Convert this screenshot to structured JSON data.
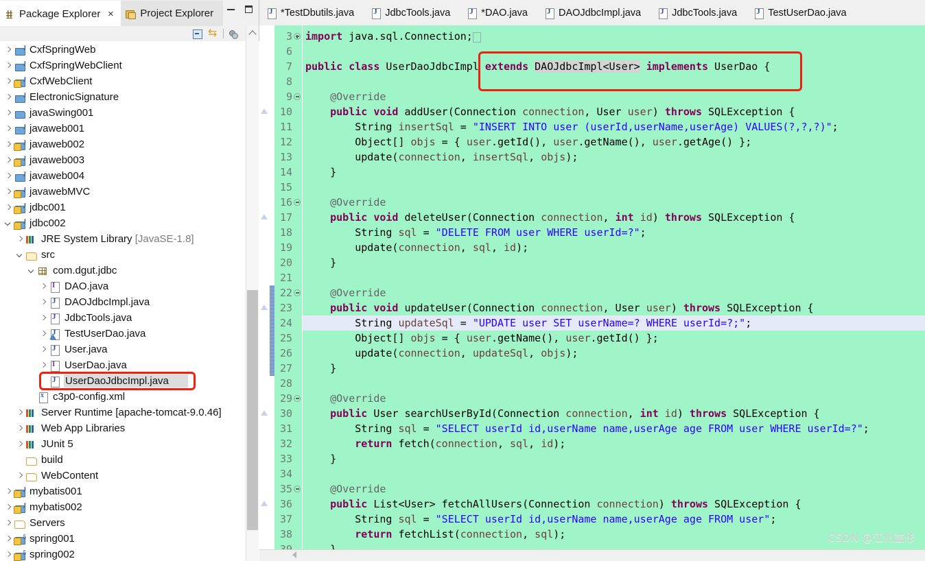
{
  "left_panel": {
    "tabs": [
      {
        "label": "Package Explorer",
        "icon": "package-explorer-icon",
        "active": true,
        "close": "×"
      },
      {
        "label": "Project Explorer",
        "icon": "project-explorer-icon",
        "active": false
      }
    ],
    "window_buttons": {
      "minimize": "minimize",
      "maximize": "maximize"
    },
    "toolbar": [
      {
        "name": "collapse-all-icon"
      },
      {
        "name": "link-with-editor-icon"
      },
      {
        "name": "view-menu-icon"
      },
      {
        "name": "view-menu-dots-icon"
      }
    ],
    "tree": [
      {
        "indent": 0,
        "twisty": "right",
        "icon": "java-web-project-icon",
        "label": "CxfSpringWeb"
      },
      {
        "indent": 0,
        "twisty": "right",
        "icon": "java-web-project-icon",
        "label": "CxfSpringWebClient"
      },
      {
        "indent": 0,
        "twisty": "right",
        "icon": "java-web-project-warn-icon",
        "label": "CxfWebClient"
      },
      {
        "indent": 0,
        "twisty": "right",
        "icon": "java-web-project-icon",
        "label": "ElectronicSignature"
      },
      {
        "indent": 0,
        "twisty": "right",
        "icon": "java-project-icon",
        "label": "javaSwing001"
      },
      {
        "indent": 0,
        "twisty": "right",
        "icon": "dynamic-web-project-icon",
        "label": "javaweb001"
      },
      {
        "indent": 0,
        "twisty": "right",
        "icon": "dynamic-web-project-warn-icon",
        "label": "javaweb002"
      },
      {
        "indent": 0,
        "twisty": "right",
        "icon": "dynamic-web-project-warn-icon",
        "label": "javaweb003"
      },
      {
        "indent": 0,
        "twisty": "right",
        "icon": "dynamic-web-project-icon",
        "label": "javaweb004"
      },
      {
        "indent": 0,
        "twisty": "right",
        "icon": "dynamic-web-project-warn-icon",
        "label": "javawebMVC"
      },
      {
        "indent": 0,
        "twisty": "right",
        "icon": "dynamic-web-project-warn-icon",
        "label": "jdbc001"
      },
      {
        "indent": 0,
        "twisty": "down",
        "icon": "dynamic-web-project-warn-icon",
        "label": "jdbc002"
      },
      {
        "indent": 1,
        "twisty": "right",
        "icon": "library-icon",
        "label": "JRE System Library ",
        "suffix": "[JavaSE-1.8]"
      },
      {
        "indent": 1,
        "twisty": "down",
        "icon": "source-folder-icon",
        "label": "src"
      },
      {
        "indent": 2,
        "twisty": "down",
        "icon": "package-icon",
        "label": "com.dgut.jdbc"
      },
      {
        "indent": 3,
        "twisty": "right",
        "icon": "java-interface-icon",
        "label": "DAO.java"
      },
      {
        "indent": 3,
        "twisty": "right",
        "icon": "java-class-icon",
        "label": "DAOJdbcImpl.java"
      },
      {
        "indent": 3,
        "twisty": "right",
        "icon": "java-class-icon",
        "label": "JdbcTools.java"
      },
      {
        "indent": 3,
        "twisty": "right",
        "icon": "java-test-class-icon",
        "label": "TestUserDao.java"
      },
      {
        "indent": 3,
        "twisty": "right",
        "icon": "java-class-icon",
        "label": "User.java"
      },
      {
        "indent": 3,
        "twisty": "right",
        "icon": "java-interface-icon",
        "label": "UserDao.java"
      },
      {
        "indent": 3,
        "twisty": "none",
        "icon": "java-class-icon",
        "label": "UserDaoJdbcImpl.java",
        "selected": true,
        "highlighted": true
      },
      {
        "indent": 2,
        "twisty": "none",
        "icon": "xml-file-icon",
        "label": "c3p0-config.xml"
      },
      {
        "indent": 1,
        "twisty": "right",
        "icon": "library-icon",
        "label": "Server Runtime [apache-tomcat-9.0.46]"
      },
      {
        "indent": 1,
        "twisty": "right",
        "icon": "library-icon",
        "label": "Web App Libraries"
      },
      {
        "indent": 1,
        "twisty": "right",
        "icon": "library-icon",
        "label": "JUnit 5"
      },
      {
        "indent": 1,
        "twisty": "none",
        "icon": "folder-icon",
        "label": "build"
      },
      {
        "indent": 1,
        "twisty": "right",
        "icon": "folder-icon",
        "label": "WebContent"
      },
      {
        "indent": 0,
        "twisty": "right",
        "icon": "dynamic-web-project-warn-icon",
        "label": "mybatis001"
      },
      {
        "indent": 0,
        "twisty": "right",
        "icon": "dynamic-web-project-warn-icon",
        "label": "mybatis002"
      },
      {
        "indent": 0,
        "twisty": "right",
        "icon": "folder-icon",
        "label": "Servers"
      },
      {
        "indent": 0,
        "twisty": "right",
        "icon": "spring-project-warn-icon",
        "label": "spring001"
      },
      {
        "indent": 0,
        "twisty": "right",
        "icon": "spring-project-warn-icon",
        "label": "spring002"
      }
    ]
  },
  "editor": {
    "tabs": [
      {
        "label": "*TestDbutils.java",
        "dirty": true
      },
      {
        "label": "JdbcTools.java",
        "dirty": false
      },
      {
        "label": "*DAO.java",
        "dirty": true
      },
      {
        "label": "DAOJdbcImpl.java",
        "dirty": false
      },
      {
        "label": "JdbcTools.java",
        "dirty": false
      },
      {
        "label": "TestUserDao.java",
        "dirty": false
      }
    ],
    "background_color": "#a0f5c8",
    "current_line_color": "#e4eaf7",
    "occurrence_highlight_color": "#d4d4d4",
    "annotation_box_color": "#ee2211",
    "lines": [
      {
        "num": "3",
        "fold": "plus",
        "ann": "none",
        "change": false,
        "current": false,
        "html": "<span class=\"kw\">import</span> java.sql.Connection;<span style=\"color:#9aa;border:1px solid #9ab;padding:0 2px;font-size:11px\">&nbsp;</span>"
      },
      {
        "num": "6",
        "fold": "none",
        "ann": "none",
        "change": false,
        "current": false,
        "html": ""
      },
      {
        "num": "7",
        "fold": "none",
        "ann": "none",
        "change": false,
        "current": false,
        "html": "<span class=\"kw\">public</span> <span class=\"kw\">class</span> UserDaoJdbcImpl <span class=\"kw\">extends</span> <span class=\"occ\">DAOJdbcImpl&lt;User&gt;</span> <span class=\"kw\">implements</span> UserDao {"
      },
      {
        "num": "8",
        "fold": "none",
        "ann": "none",
        "change": false,
        "current": false,
        "html": ""
      },
      {
        "num": "9",
        "fold": "minus",
        "ann": "none",
        "change": false,
        "current": false,
        "html": "    <span class=\"ann\">@Override</span>"
      },
      {
        "num": "10",
        "fold": "none",
        "ann": "impl",
        "change": false,
        "current": false,
        "html": "    <span class=\"kw\">public</span> <span class=\"kw\">void</span> addUser(Connection <span class=\"var\">connection</span>, User <span class=\"var\">user</span>) <span class=\"kw\">throws</span> SQLException {"
      },
      {
        "num": "11",
        "fold": "none",
        "ann": "none",
        "change": false,
        "current": false,
        "html": "        String <span class=\"var\">insertSql</span> = <span class=\"str\">\"INSERT INTO user (userId,userName,userAge) VALUES(?,?,?)\"</span>;"
      },
      {
        "num": "12",
        "fold": "none",
        "ann": "none",
        "change": false,
        "current": false,
        "html": "        Object[] <span class=\"var\">objs</span> = { <span class=\"var\">user</span>.getId(), <span class=\"var\">user</span>.getName(), <span class=\"var\">user</span>.getAge() };"
      },
      {
        "num": "13",
        "fold": "none",
        "ann": "none",
        "change": false,
        "current": false,
        "html": "        update(<span class=\"var\">connection</span>, <span class=\"var\">insertSql</span>, <span class=\"var\">objs</span>);"
      },
      {
        "num": "14",
        "fold": "none",
        "ann": "none",
        "change": false,
        "current": false,
        "html": "    }"
      },
      {
        "num": "15",
        "fold": "none",
        "ann": "none",
        "change": false,
        "current": false,
        "html": ""
      },
      {
        "num": "16",
        "fold": "minus",
        "ann": "none",
        "change": false,
        "current": false,
        "html": "    <span class=\"ann\">@Override</span>"
      },
      {
        "num": "17",
        "fold": "none",
        "ann": "impl",
        "change": false,
        "current": false,
        "html": "    <span class=\"kw\">public</span> <span class=\"kw\">void</span> deleteUser(Connection <span class=\"var\">connection</span>, <span class=\"kw\">int</span> <span class=\"var\">id</span>) <span class=\"kw\">throws</span> SQLException {"
      },
      {
        "num": "18",
        "fold": "none",
        "ann": "none",
        "change": false,
        "current": false,
        "html": "        String <span class=\"var\">sql</span> = <span class=\"str\">\"DELETE FROM user WHERE userId=?\"</span>;"
      },
      {
        "num": "19",
        "fold": "none",
        "ann": "none",
        "change": false,
        "current": false,
        "html": "        update(<span class=\"var\">connection</span>, <span class=\"var\">sql</span>, <span class=\"var\">id</span>);"
      },
      {
        "num": "20",
        "fold": "none",
        "ann": "none",
        "change": false,
        "current": false,
        "html": "    }"
      },
      {
        "num": "21",
        "fold": "none",
        "ann": "none",
        "change": false,
        "current": false,
        "html": ""
      },
      {
        "num": "22",
        "fold": "minus",
        "ann": "none",
        "change": true,
        "current": false,
        "html": "    <span class=\"ann\">@Override</span>"
      },
      {
        "num": "23",
        "fold": "none",
        "ann": "impl",
        "change": true,
        "current": false,
        "html": "    <span class=\"kw\">public</span> <span class=\"kw\">void</span> updateUser(Connection <span class=\"var\">connection</span>, User <span class=\"var\">user</span>) <span class=\"kw\">throws</span> SQLException {"
      },
      {
        "num": "24",
        "fold": "none",
        "ann": "none",
        "change": true,
        "current": true,
        "html": "        String <span class=\"var\">updateSql</span> = <span class=\"str\">\"UPDATE user SET userName=? WHERE userId=?;\"</span>;"
      },
      {
        "num": "25",
        "fold": "none",
        "ann": "none",
        "change": true,
        "current": false,
        "html": "        Object[] <span class=\"var\">objs</span> = { <span class=\"var\">user</span>.getName(), <span class=\"var\">user</span>.getId() };"
      },
      {
        "num": "26",
        "fold": "none",
        "ann": "none",
        "change": true,
        "current": false,
        "html": "        update(<span class=\"var\">connection</span>, <span class=\"var\">updateSql</span>, <span class=\"var\">objs</span>);"
      },
      {
        "num": "27",
        "fold": "none",
        "ann": "none",
        "change": true,
        "current": false,
        "html": "    }"
      },
      {
        "num": "28",
        "fold": "none",
        "ann": "none",
        "change": false,
        "current": false,
        "html": ""
      },
      {
        "num": "29",
        "fold": "minus",
        "ann": "none",
        "change": false,
        "current": false,
        "html": "    <span class=\"ann\">@Override</span>"
      },
      {
        "num": "30",
        "fold": "none",
        "ann": "impl",
        "change": false,
        "current": false,
        "html": "    <span class=\"kw\">public</span> User searchUserById(Connection <span class=\"var\">connection</span>, <span class=\"kw\">int</span> <span class=\"var\">id</span>) <span class=\"kw\">throws</span> SQLException {"
      },
      {
        "num": "31",
        "fold": "none",
        "ann": "none",
        "change": false,
        "current": false,
        "html": "        String <span class=\"var\">sql</span> = <span class=\"str\">\"SELECT userId id,userName name,userAge age FROM user WHERE userId=?\"</span>;"
      },
      {
        "num": "32",
        "fold": "none",
        "ann": "none",
        "change": false,
        "current": false,
        "html": "        <span class=\"kw\">return</span> fetch(<span class=\"var\">connection</span>, <span class=\"var\">sql</span>, <span class=\"var\">id</span>);"
      },
      {
        "num": "33",
        "fold": "none",
        "ann": "none",
        "change": false,
        "current": false,
        "html": "    }"
      },
      {
        "num": "34",
        "fold": "none",
        "ann": "none",
        "change": false,
        "current": false,
        "html": ""
      },
      {
        "num": "35",
        "fold": "minus",
        "ann": "none",
        "change": false,
        "current": false,
        "html": "    <span class=\"ann\">@Override</span>"
      },
      {
        "num": "36",
        "fold": "none",
        "ann": "impl",
        "change": false,
        "current": false,
        "html": "    <span class=\"kw\">public</span> List&lt;User&gt; fetchAllUsers(Connection <span class=\"var\">connection</span>) <span class=\"kw\">throws</span> SQLException {"
      },
      {
        "num": "37",
        "fold": "none",
        "ann": "none",
        "change": false,
        "current": false,
        "html": "        String <span class=\"var\">sql</span> = <span class=\"str\">\"SELECT userId id,userName name,userAge age FROM user\"</span>;"
      },
      {
        "num": "38",
        "fold": "none",
        "ann": "none",
        "change": false,
        "current": false,
        "html": "        <span class=\"kw\">return</span> fetchList(<span class=\"var\">connection</span>, <span class=\"var\">sql</span>);"
      },
      {
        "num": "39",
        "fold": "none",
        "ann": "none",
        "change": false,
        "current": false,
        "html": "    }"
      }
    ]
  },
  "watermark": "CSDN @江州益彤"
}
